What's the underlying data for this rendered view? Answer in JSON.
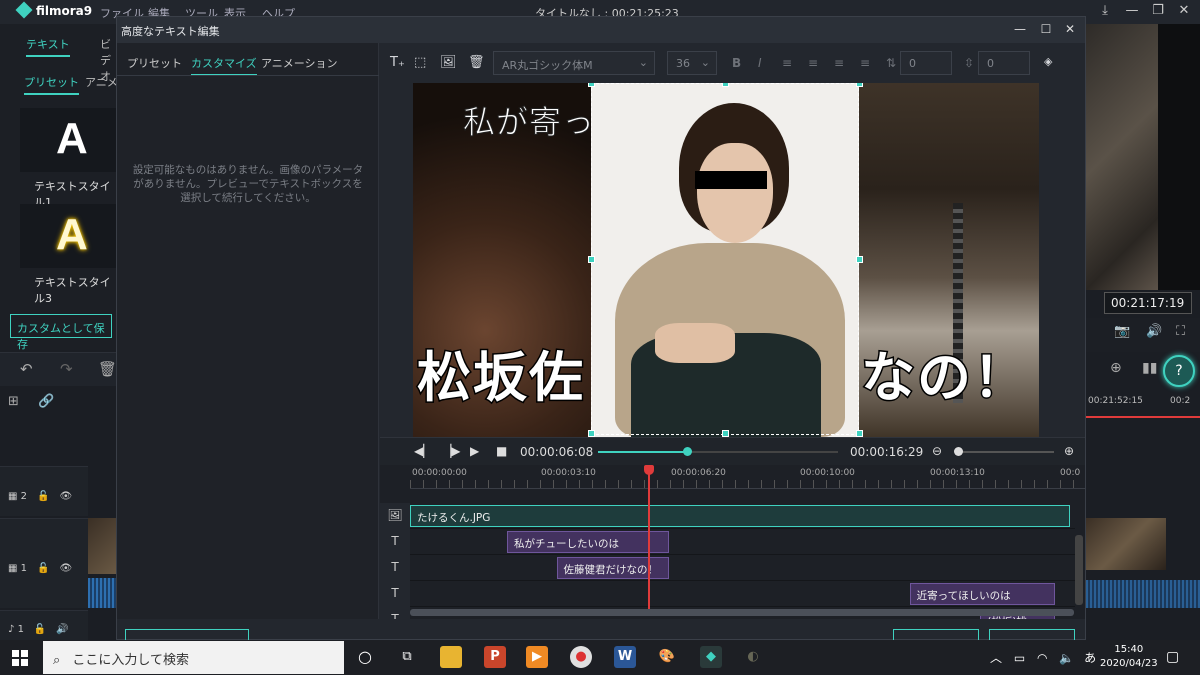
{
  "app": {
    "name": "filmora9",
    "menu": [
      "ファイル",
      "編集",
      "ツール",
      "表示",
      "ヘルプ"
    ],
    "title": "タイトルなし : 00:21:25:23"
  },
  "left_panel": {
    "tabs": [
      "テキスト",
      "ビデオ"
    ],
    "subtabs": [
      "プリセット",
      "アニメ"
    ],
    "styles": [
      {
        "glyph": "A",
        "label": "テキストスタイル1"
      },
      {
        "glyph": "A",
        "label": "テキストスタイル3"
      }
    ],
    "save_custom": "カスタムとして保存"
  },
  "main_tracks": [
    {
      "label": "2"
    },
    {
      "label": "1"
    },
    {
      "label": "1"
    }
  ],
  "right": {
    "preview_time": "00:21:17:19",
    "ruler_time": "00:21:52:15",
    "ruler_time2": "00:2"
  },
  "dialog": {
    "title": "高度なテキスト編集",
    "tabs": [
      "プリセット",
      "カスタマイズ",
      "アニメーション"
    ],
    "active_tab": "カスタマイズ",
    "no_settings": "設定可能なものはありません。画像のパラメータがありません。プレビューでテキストボックスを選択して続行してください。",
    "toolbar": {
      "font": "AR丸ゴシック体M",
      "size": "36",
      "spacing1": "0",
      "spacing2": "0"
    },
    "preview": {
      "text_top": "私が寄っ",
      "text_big_left": "松坂佐",
      "text_big_right": "なの！"
    },
    "playback": {
      "current": "00:00:06:08",
      "total": "00:00:16:29",
      "progress": 0.37,
      "zoom": 0.0
    },
    "ruler": [
      "00:00:00:00",
      "00:00:03:10",
      "00:00:06:20",
      "00:00:10:00",
      "00:00:13:10",
      "00:0"
    ],
    "tracks": [
      {
        "icon": "image",
        "clips": [
          {
            "label": "たけるくん.JPG",
            "kind": "img",
            "start": 0.0,
            "end": 1.0
          }
        ]
      },
      {
        "icon": "T",
        "clips": [
          {
            "label": "私がチューしたいのは",
            "kind": "text",
            "start": 0.147,
            "end": 0.393
          }
        ]
      },
      {
        "icon": "T",
        "clips": [
          {
            "label": "佐藤健君だけなの！",
            "kind": "text",
            "start": 0.222,
            "end": 0.393
          }
        ]
      },
      {
        "icon": "T",
        "clips": [
          {
            "label": "近寄ってほしいのは",
            "kind": "text",
            "start": 0.757,
            "end": 0.978
          }
        ]
      },
      {
        "icon": "T",
        "clips": [
          {
            "label": "(松坂)桃",
            "kind": "text",
            "start": 0.864,
            "end": 0.978
          }
        ]
      }
    ],
    "playhead": 0.36
  },
  "taskbar": {
    "search_placeholder": "ここに入力して検索",
    "ime": "あ",
    "time": "15:40",
    "date": "2020/04/23"
  },
  "colors": {
    "accent": "#3fd2c0",
    "text_clip": "#43325f",
    "playhead": "#e03b3b"
  }
}
